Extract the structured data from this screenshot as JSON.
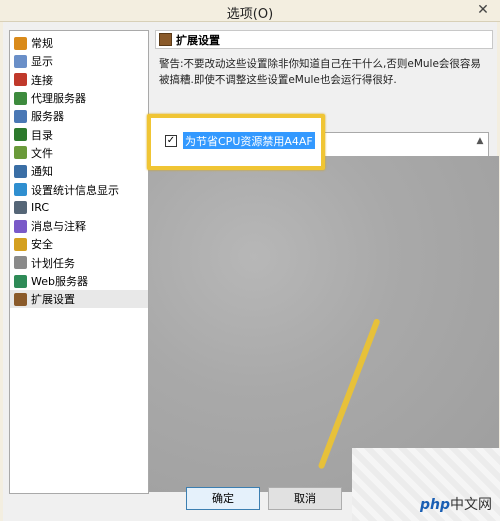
{
  "window": {
    "title": "选项(O)",
    "close_glyph": "✕"
  },
  "sidebar": {
    "items": [
      {
        "label": "常规",
        "icon": "general-icon",
        "color": "#d98a1a"
      },
      {
        "label": "显示",
        "icon": "display-icon",
        "color": "#6a8fc8"
      },
      {
        "label": "连接",
        "icon": "connection-icon",
        "color": "#c0392b"
      },
      {
        "label": "代理服务器",
        "icon": "proxy-icon",
        "color": "#3d8b3d"
      },
      {
        "label": "服务器",
        "icon": "server-icon",
        "color": "#4a78b5"
      },
      {
        "label": "目录",
        "icon": "directory-icon",
        "color": "#2d7a2d"
      },
      {
        "label": "文件",
        "icon": "file-icon",
        "color": "#6a9a3a"
      },
      {
        "label": "通知",
        "icon": "notification-icon",
        "color": "#3a6ea5"
      },
      {
        "label": "设置统计信息显示",
        "icon": "statistics-icon",
        "color": "#2f8fd0"
      },
      {
        "label": "IRC",
        "icon": "irc-icon",
        "color": "#556677"
      },
      {
        "label": "消息与注释",
        "icon": "messages-icon",
        "color": "#7a5ac8"
      },
      {
        "label": "安全",
        "icon": "security-icon",
        "color": "#d4a020"
      },
      {
        "label": "计划任务",
        "icon": "scheduler-icon",
        "color": "#8a8a8a"
      },
      {
        "label": "Web服务器",
        "icon": "web-server-icon",
        "color": "#2e8b57"
      },
      {
        "label": "扩展设置",
        "icon": "extended-settings-icon",
        "color": "#8a5a2a"
      }
    ],
    "active_index": 14
  },
  "panel": {
    "heading": "扩展设置",
    "warning": "警告:不要改动这些设置除非你知道自己在干什么,否则eMule会很容易被搞糟.即使不调整这些设置eMule也会运行得很好."
  },
  "options": [
    {
      "label": "为节省CPU资源禁用A4AF",
      "checked": true,
      "check_glyph": "✓"
    }
  ],
  "listbox": {
    "scroll_up_glyph": "▲"
  },
  "buttons": {
    "ok": "确定",
    "cancel": "取消"
  },
  "watermark": {
    "text_a": "php",
    "text_b": "中文网"
  },
  "colors": {
    "highlight_border": "#f0c534",
    "selection": "#3399ff"
  }
}
